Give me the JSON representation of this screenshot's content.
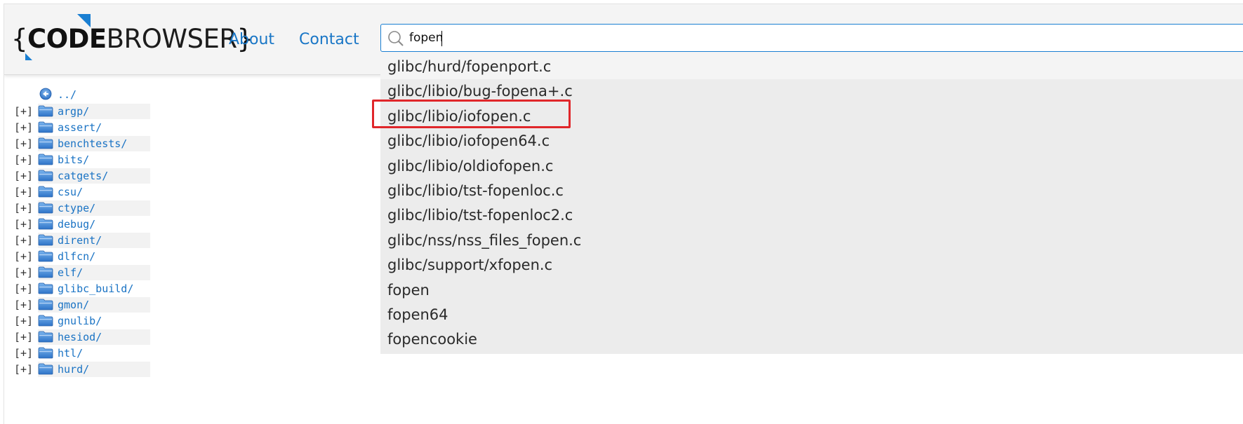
{
  "header": {
    "logo": {
      "brace_open": "{",
      "bold": "CODE",
      "light": "BROWSER",
      "brace_close": "}"
    },
    "nav": [
      {
        "label": "About"
      },
      {
        "label": "Contact"
      }
    ],
    "search": {
      "value": "fopen",
      "placeholder": ""
    }
  },
  "tree": {
    "up": {
      "label": "../"
    },
    "expander": "[+]",
    "items": [
      {
        "label": "argp/"
      },
      {
        "label": "assert/"
      },
      {
        "label": "benchtests/"
      },
      {
        "label": "bits/"
      },
      {
        "label": "catgets/"
      },
      {
        "label": "csu/"
      },
      {
        "label": "ctype/"
      },
      {
        "label": "debug/"
      },
      {
        "label": "dirent/"
      },
      {
        "label": "dlfcn/"
      },
      {
        "label": "elf/"
      },
      {
        "label": "glibc_build/"
      },
      {
        "label": "gmon/"
      },
      {
        "label": "gnulib/"
      },
      {
        "label": "hesiod/"
      },
      {
        "label": "htl/"
      },
      {
        "label": "hurd/"
      }
    ]
  },
  "suggestions": [
    {
      "label": "glibc/hurd/fopenport.c"
    },
    {
      "label": "glibc/libio/bug-fopena+.c"
    },
    {
      "label": "glibc/libio/iofopen.c"
    },
    {
      "label": "glibc/libio/iofopen64.c"
    },
    {
      "label": "glibc/libio/oldiofopen.c"
    },
    {
      "label": "glibc/libio/tst-fopenloc.c"
    },
    {
      "label": "glibc/libio/tst-fopenloc2.c"
    },
    {
      "label": "glibc/nss/nss_files_fopen.c"
    },
    {
      "label": "glibc/support/xfopen.c"
    },
    {
      "label": "fopen"
    },
    {
      "label": "fopen64"
    },
    {
      "label": "fopencookie"
    }
  ],
  "colors": {
    "accent": "#1a7fd2",
    "link": "#1976c6",
    "highlight": "#e0262a",
    "dropdown_bg": "#ececec"
  }
}
